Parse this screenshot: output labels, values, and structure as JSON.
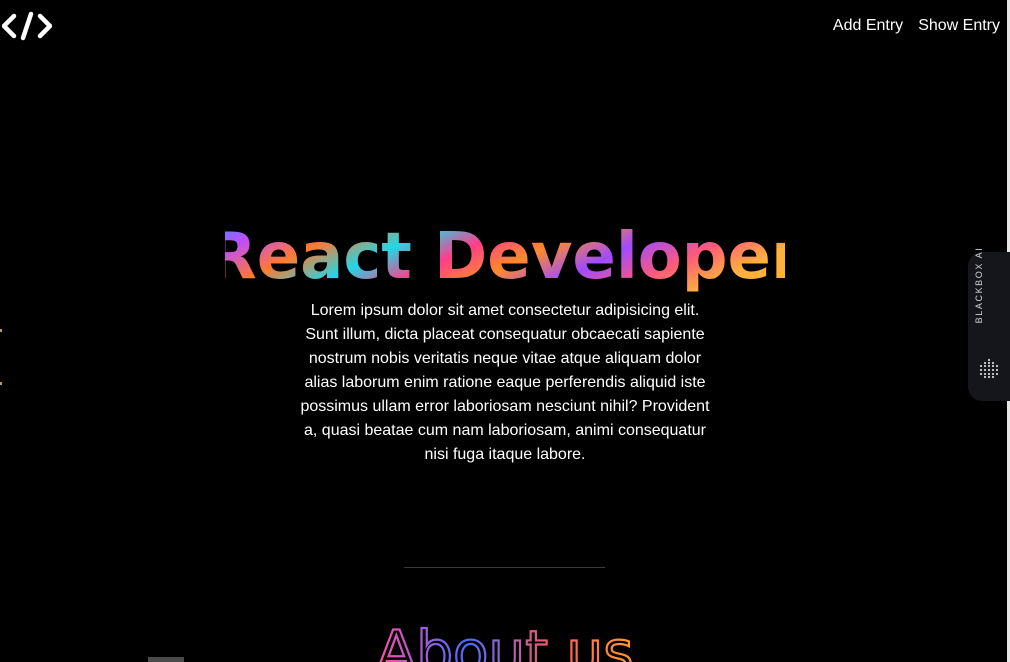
{
  "nav": {
    "logo_icon": "code-brackets-icon",
    "links": [
      {
        "label": "Add Entry"
      },
      {
        "label": "Show Entry"
      }
    ]
  },
  "hero": {
    "title": "React Developer",
    "paragraph": "Lorem ipsum dolor sit amet consectetur adipisicing elit. Sunt illum, dicta placeat consequatur obcaecati sapiente nostrum nobis veritatis neque vitae atque aliquam dolor alias laborum enim ratione eaque perferendis aliquid iste possimus ullam error laboriosam nesciunt nihil? Provident a, quasi beatae cum nam laboriosam, animi consequatur nisi fuga itaque labore."
  },
  "about": {
    "title": "About us"
  },
  "side_widget": {
    "label": "BLACKBOX AI",
    "icon": "dot-grid-icon"
  },
  "colors": {
    "background": "#000000",
    "gradient": [
      "#1fa2ff",
      "#a04bff",
      "#ff3d8b",
      "#ff8a2a",
      "#ffc53d"
    ],
    "widget_bg": "#15161b"
  }
}
